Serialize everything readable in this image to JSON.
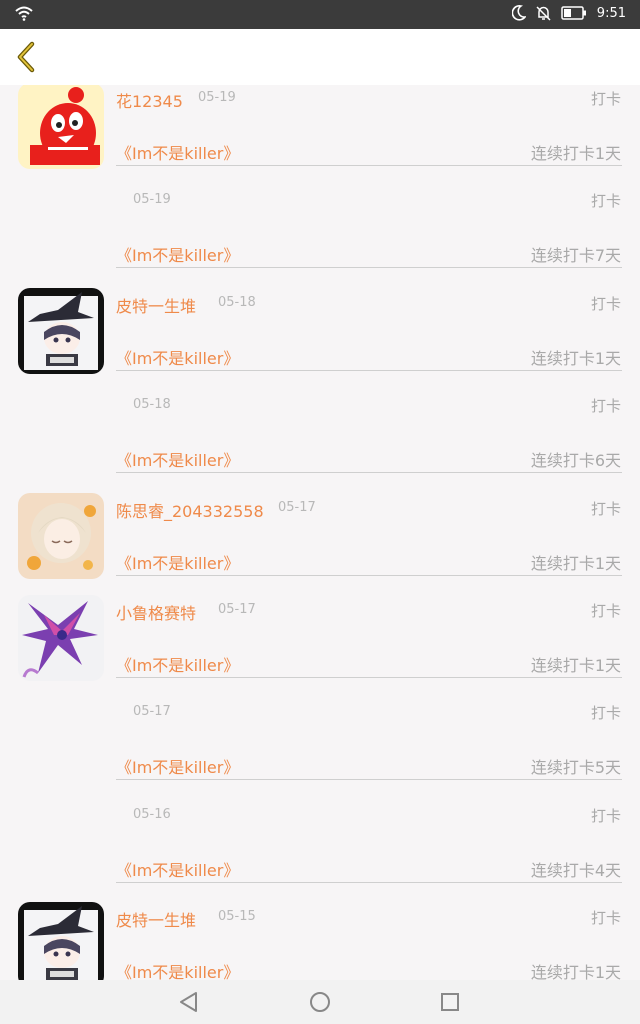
{
  "status_bar": {
    "time": "9:51"
  },
  "header": {
    "back_icon": "chevron-left-icon"
  },
  "entries": [
    {
      "name": "花12345",
      "date": "05-19",
      "action": "打卡",
      "book": "《Im不是killer》",
      "streak": "连续打卡1天",
      "avatar": "qq-penguin"
    },
    {
      "name": "",
      "date": "05-19",
      "action": "打卡",
      "book": "《Im不是killer》",
      "streak": "连续打卡7天",
      "avatar": ""
    },
    {
      "name": "皮特一生堆",
      "date": "05-18",
      "action": "打卡",
      "book": "《Im不是killer》",
      "streak": "连续打卡1天",
      "avatar": "witch-boy"
    },
    {
      "name": "",
      "date": "05-18",
      "action": "打卡",
      "book": "《Im不是killer》",
      "streak": "连续打卡6天",
      "avatar": ""
    },
    {
      "name": "陈思睿_204332558",
      "date": "05-17",
      "action": "打卡",
      "book": "《Im不是killer》",
      "streak": "连续打卡1天",
      "avatar": "anime-girl"
    },
    {
      "name": "小鲁格赛特",
      "date": "05-17",
      "action": "打卡",
      "book": "《Im不是killer》",
      "streak": "连续打卡1天",
      "avatar": "dragon"
    },
    {
      "name": "",
      "date": "05-17",
      "action": "打卡",
      "book": "《Im不是killer》",
      "streak": "连续打卡5天",
      "avatar": ""
    },
    {
      "name": "",
      "date": "05-16",
      "action": "打卡",
      "book": "《Im不是killer》",
      "streak": "连续打卡4天",
      "avatar": ""
    },
    {
      "name": "皮特一生堆",
      "date": "05-15",
      "action": "打卡",
      "book": "《Im不是killer》",
      "streak": "连续打卡1天",
      "avatar": "witch-boy"
    }
  ],
  "nav": {
    "back": "back-triangle-icon",
    "home": "home-circle-icon",
    "recent": "recent-square-icon"
  }
}
